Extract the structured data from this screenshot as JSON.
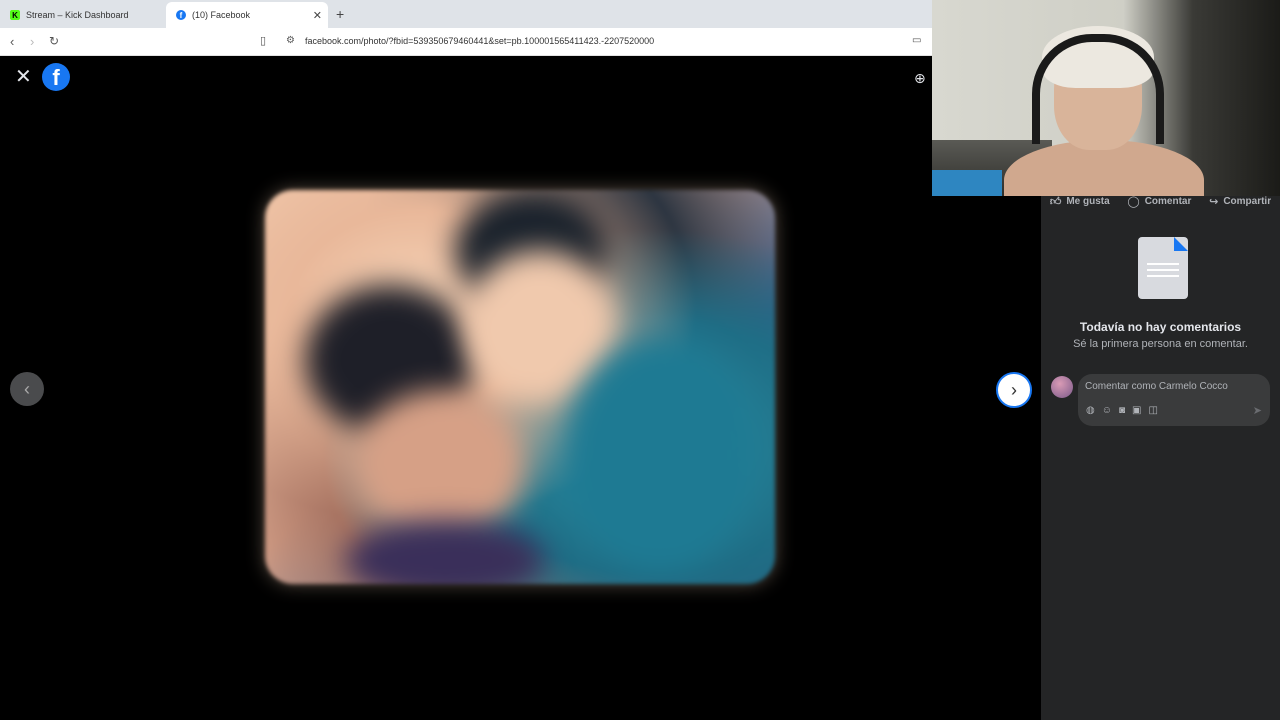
{
  "browser": {
    "tabs": [
      {
        "label": "Stream – Kick Dashboard",
        "icon": "kick-icon"
      },
      {
        "label": "(10) Facebook",
        "icon": "facebook-icon"
      }
    ],
    "url": "facebook.com/photo/?fbid=539350679460441&set=pb.100001565411423.-2207520000"
  },
  "viewer": {
    "prev_icon": "chevron-left-icon",
    "next_icon": "chevron-right-icon",
    "close_icon": "close-icon",
    "zoom_icon": "zoom-in-icon"
  },
  "panel": {
    "actions": [
      {
        "label": "Me gusta",
        "icon": "like-icon"
      },
      {
        "label": "Comentar",
        "icon": "comment-icon"
      },
      {
        "label": "Compartir",
        "icon": "share-icon"
      }
    ],
    "empty_title": "Todavía no hay comentarios",
    "empty_subtitle": "Sé la primera persona en comentar.",
    "comment_placeholder": "Comentar como Carmelo Cocco"
  }
}
